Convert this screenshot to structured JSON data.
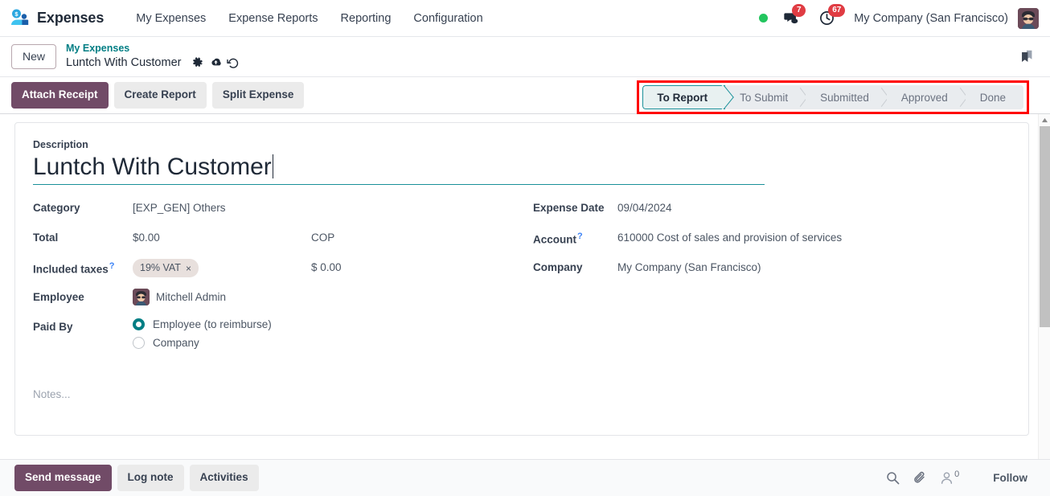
{
  "navbar": {
    "app_icon": "expenses-app-icon",
    "app_title": "Expenses",
    "menu": [
      {
        "label": "My Expenses"
      },
      {
        "label": "Expense Reports"
      },
      {
        "label": "Reporting"
      },
      {
        "label": "Configuration"
      }
    ],
    "presence_dot": "online-status-dot",
    "messages": {
      "icon": "messages-icon",
      "count": "7"
    },
    "activities": {
      "icon": "clock-activities-icon",
      "count": "67"
    },
    "company": "My Company (San Francisco)",
    "avatar": "user-avatar"
  },
  "breadcrumb": {
    "new_label": "New",
    "parent": "My Expenses",
    "current": "Luntch With Customer",
    "icons": [
      "gear-icon",
      "cloud-save-icon",
      "discard-undo-icon"
    ],
    "bookmark": "bookmark-icon"
  },
  "control_panel": {
    "buttons": [
      {
        "label": "Attach Receipt",
        "style": "primary"
      },
      {
        "label": "Create Report",
        "style": "secondary"
      },
      {
        "label": "Split Expense",
        "style": "secondary"
      }
    ],
    "statusbar": {
      "highlight_color": "#ff0000",
      "active_index": 0,
      "stages": [
        {
          "label": "To Report"
        },
        {
          "label": "To Submit"
        },
        {
          "label": "Submitted"
        },
        {
          "label": "Approved"
        },
        {
          "label": "Done"
        }
      ]
    }
  },
  "form": {
    "description_label": "Description",
    "description_value": "Luntch With Customer",
    "left": {
      "category_label": "Category",
      "category_value": "[EXP_GEN] Others",
      "total_label": "Total",
      "total_value": "$0.00",
      "total_currency": "COP",
      "taxes_label": "Included taxes",
      "taxes_tag": "19% VAT",
      "taxes_tag_remove": "×",
      "taxes_amount": "$ 0.00",
      "employee_label": "Employee",
      "employee_value": "Mitchell Admin",
      "paid_by_label": "Paid By",
      "paid_by_options": [
        {
          "label": "Employee (to reimburse)",
          "checked": true
        },
        {
          "label": "Company",
          "checked": false
        }
      ]
    },
    "right": {
      "expense_date_label": "Expense Date",
      "expense_date_value": "09/04/2024",
      "account_label": "Account",
      "account_value": "610000 Cost of sales and provision of services",
      "company_label": "Company",
      "company_value": "My Company (San Francisco)"
    },
    "notes_placeholder": "Notes...",
    "tooltip_marker": "?"
  },
  "chatter": {
    "send_message": "Send message",
    "log_note": "Log note",
    "activities": "Activities",
    "search_icon": "search-icon",
    "attachment_icon": "paperclip-icon",
    "followers_icon": "followers-icon",
    "followers_count": "0",
    "follow_label": "Follow"
  },
  "colors": {
    "primary": "#714b67",
    "accent_teal": "#017e84",
    "badge_red": "#e03c43",
    "online_green": "#22c55e",
    "highlight_red": "#ff0000"
  }
}
